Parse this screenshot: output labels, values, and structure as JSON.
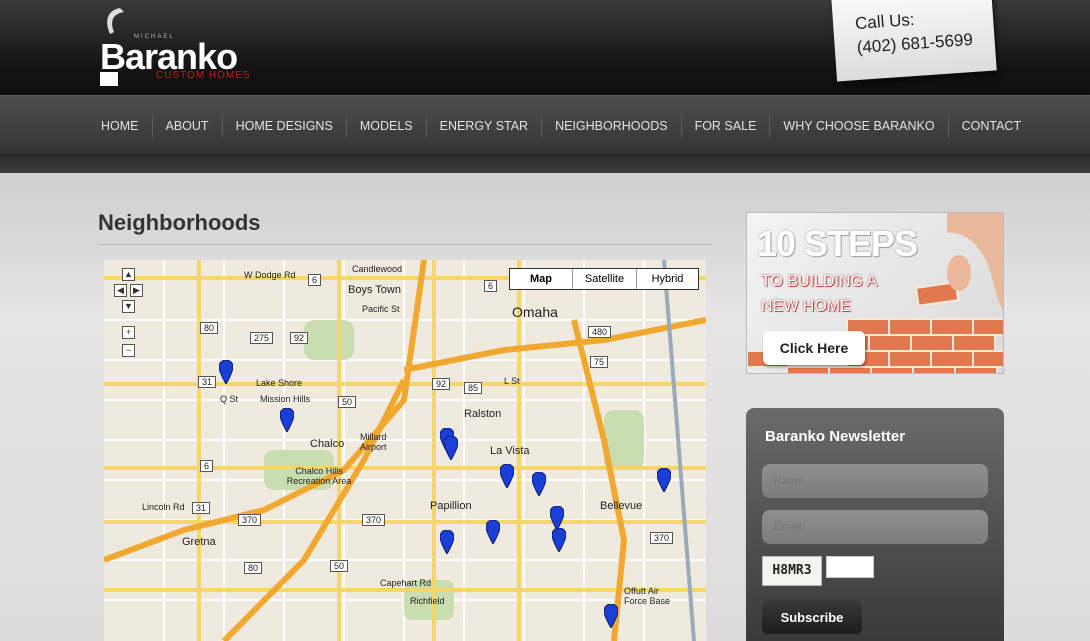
{
  "brand": {
    "small_text": "MICHAEL",
    "name": "Baranko",
    "tagline": "CUSTOM HOMES"
  },
  "call": {
    "label": "Call Us:",
    "phone": "(402) 681-5699"
  },
  "nav": {
    "items": [
      "HOME",
      "ABOUT",
      "HOME DESIGNS",
      "MODELS",
      "ENERGY STAR",
      "NEIGHBORHOODS",
      "FOR SALE",
      "WHY CHOOSE BARANKO",
      "CONTACT"
    ]
  },
  "page": {
    "title": "Neighborhoods"
  },
  "map": {
    "types": {
      "map": "Map",
      "satellite": "Satellite",
      "hybrid": "Hybrid"
    },
    "labels": {
      "omaha": "Omaha",
      "boys_town": "Boys Town",
      "candlewood": "Candlewood",
      "lake_shore": "Lake Shore",
      "mission_hills": "Mission Hills",
      "chalco": "Chalco",
      "millard_airport": "Millard Airport",
      "chalco_hills": "Chalco Hills Recreation Area",
      "ralston": "Ralston",
      "la_vista": "La Vista",
      "papillion": "Papillion",
      "bellevue": "Bellevue",
      "gretna": "Gretna",
      "richfield": "Richfield",
      "capehart_rd": "Capehart Rd",
      "lincoln_rd": "Lincoln Rd",
      "offutt": "Offutt Air Force Base",
      "w_dodge_rd": "W Dodge Rd",
      "pacific_st": "Pacific St",
      "q_st": "Q St",
      "l_st": "L St"
    },
    "shields": [
      "6",
      "6",
      "275",
      "92",
      "31",
      "50",
      "92",
      "85",
      "480",
      "75",
      "80",
      "6",
      "370",
      "31",
      "370",
      "50",
      "80",
      "370"
    ]
  },
  "promo": {
    "headline": "10 STEPS",
    "sub_line1": "TO BUILDING A",
    "sub_line2": "NEW HOME",
    "button": "Click Here"
  },
  "newsletter": {
    "title": "Baranko Newsletter",
    "name_placeholder": "Name:",
    "email_placeholder": "Email:",
    "captcha": "H8MR3",
    "submit": "Subscribe"
  },
  "colors": {
    "brand_red": "#c21d1d",
    "pin_blue": "#1a3fd6"
  }
}
